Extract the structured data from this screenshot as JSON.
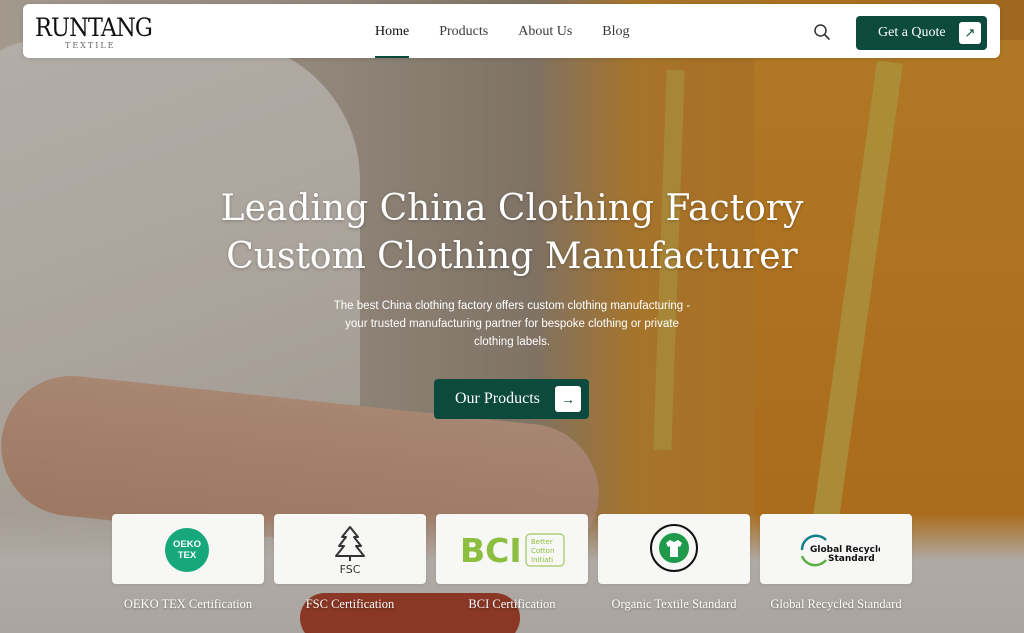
{
  "header": {
    "logo": {
      "main": "RUNTANG",
      "sub": "TEXTILE"
    },
    "nav": [
      {
        "label": "Home",
        "active": true
      },
      {
        "label": "Products",
        "active": false
      },
      {
        "label": "About Us",
        "active": false
      },
      {
        "label": "Blog",
        "active": false
      }
    ],
    "search_icon": "search-icon",
    "quote_button": {
      "label": "Get a Quote",
      "icon": "arrow-up-right-icon"
    }
  },
  "hero": {
    "title_line1": "Leading China Clothing Factory",
    "title_line2": "Custom Clothing Manufacturer",
    "subtitle": "The best China clothing factory offers custom clothing manufacturing - your trusted manufacturing partner for bespoke clothing or private clothing labels.",
    "cta": {
      "label": "Our Products",
      "icon": "arrow-right-icon"
    }
  },
  "certifications": [
    {
      "label": "OEKO TEX Certification",
      "logo": "oeko-tex-logo",
      "logo_text": [
        "OEKO",
        "TEX"
      ]
    },
    {
      "label": "FSC Certification",
      "logo": "fsc-logo",
      "logo_text": [
        "FSC"
      ]
    },
    {
      "label": "BCI Certification",
      "logo": "bci-logo",
      "logo_text": [
        "BCI",
        "Better",
        "Cotton",
        "Initiati"
      ]
    },
    {
      "label": "Organic Textile Standard",
      "logo": "gots-logo",
      "logo_text": []
    },
    {
      "label": "Global Recycled Standard",
      "logo": "grs-logo",
      "logo_text": [
        "Global Recycled",
        "Standard"
      ]
    }
  ],
  "colors": {
    "brand": "#0b4a3d",
    "oeko": "#16a77a",
    "bci": "#8cbf3f"
  }
}
